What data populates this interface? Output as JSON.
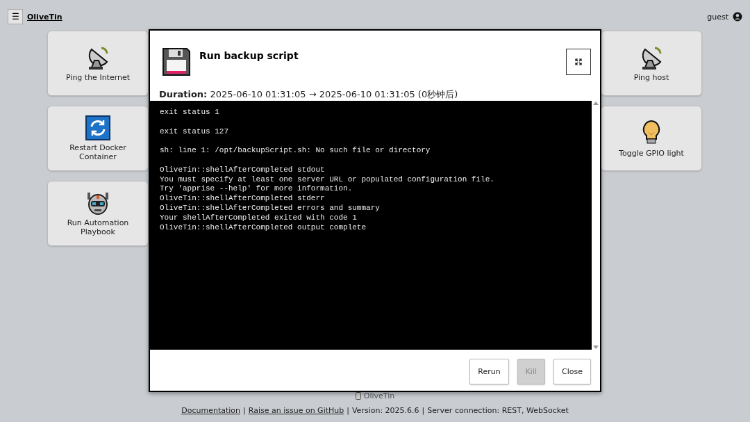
{
  "header": {
    "menu_glyph": "☰",
    "title": "OliveTin",
    "user": "guest"
  },
  "actions_left": [
    {
      "label": "Ping the Internet",
      "kind": "dish"
    },
    {
      "label": "Restart Docker Container",
      "kind": "restart"
    },
    {
      "label": "Run Automation Playbook",
      "kind": "robot"
    }
  ],
  "actions_right": [
    {
      "label": "Ping host",
      "kind": "dish"
    },
    {
      "label": "Toggle GPIO light",
      "kind": "bulb"
    }
  ],
  "dialog": {
    "title": "Run backup script",
    "duration_label": "Duration:",
    "duration_value": "2025-06-10 01:31:05 → 2025-06-10 01:31:05 (0秒钟后)",
    "output_blocks": [
      [
        "exit status 1"
      ],
      [
        "exit status 127"
      ],
      [
        "sh: line 1: /opt/backupScript.sh: No such file or directory"
      ],
      [
        "OliveTin::shellAfterCompleted stdout",
        "You must specify at least one server URL or populated configuration file.",
        "Try 'apprise --help' for more information.",
        "OliveTin::shellAfterCompleted stderr",
        "OliveTin::shellAfterCompleted errors and summary",
        "Your shellAfterCompleted exited with code 1",
        "OliveTin::shellAfterCompleted output complete"
      ]
    ],
    "buttons": [
      {
        "label": "Rerun",
        "disabled": false
      },
      {
        "label": "Kill",
        "disabled": true
      },
      {
        "label": "Close",
        "disabled": false
      }
    ]
  },
  "footer": {
    "brand": "OliveTin",
    "links": [
      {
        "text": "Documentation",
        "kind": "link"
      },
      {
        "text": "Raise an issue on GitHub",
        "kind": "link"
      },
      {
        "text": "Version: 2025.6.6",
        "kind": "text"
      },
      {
        "text": "Server connection: REST, WebSocket",
        "kind": "text"
      }
    ],
    "separator": "|"
  }
}
